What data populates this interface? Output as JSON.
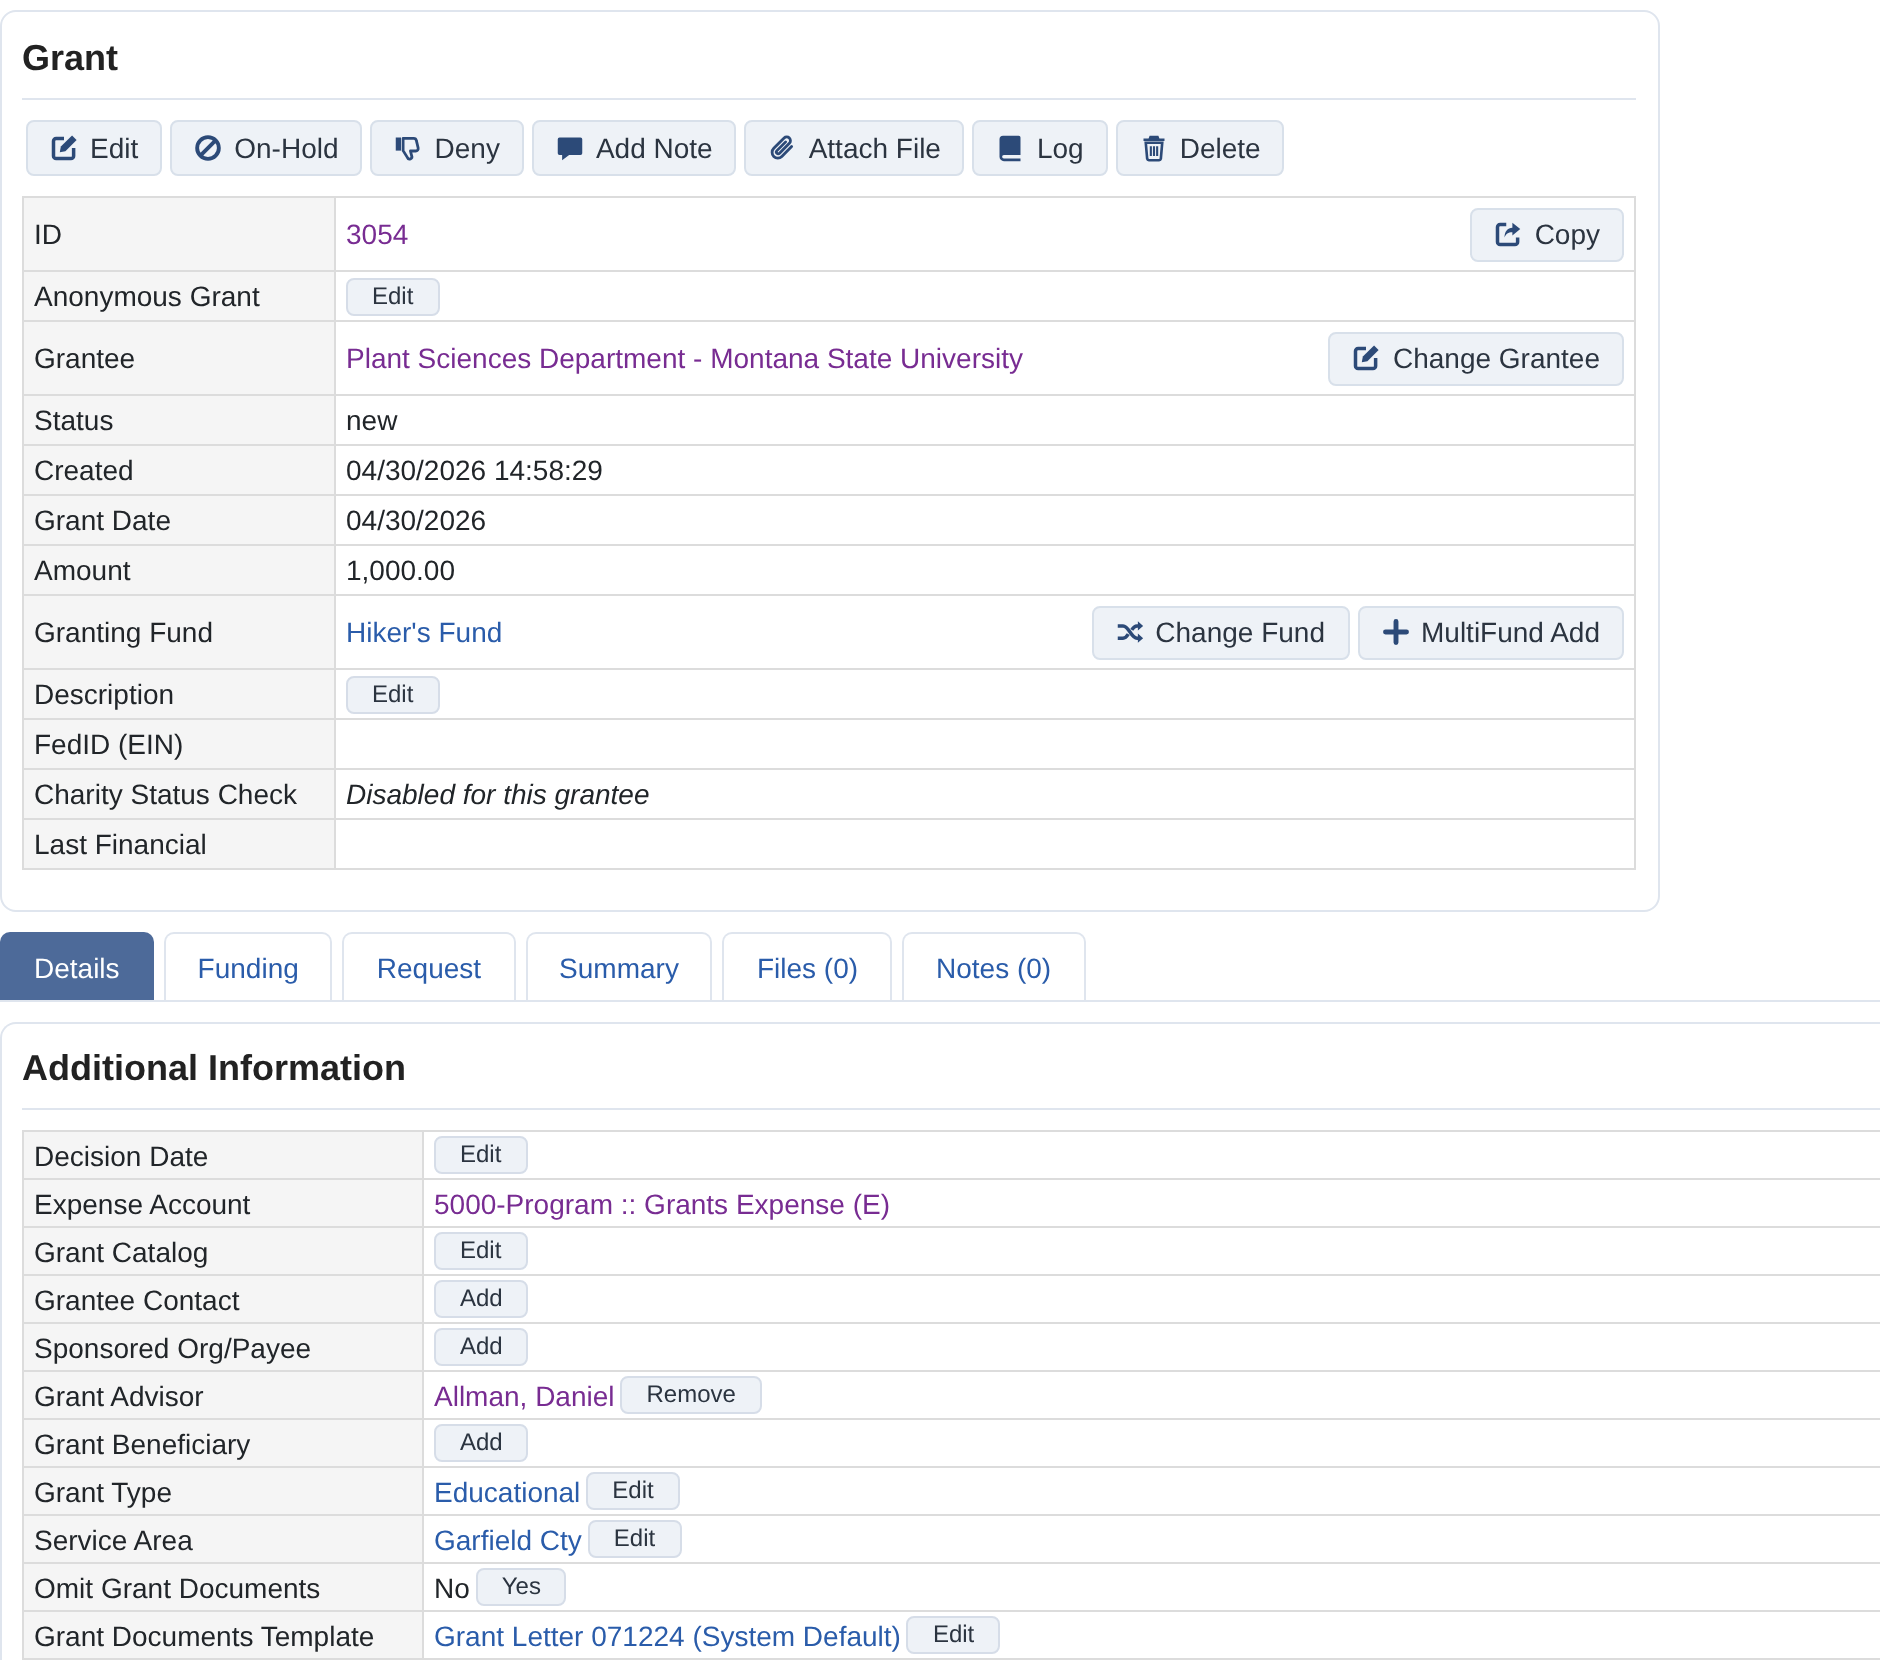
{
  "grant_panel": {
    "title": "Grant",
    "toolbar": [
      {
        "label": "Edit",
        "kind": "edit"
      },
      {
        "label": "On-Hold",
        "kind": "hold"
      },
      {
        "label": "Deny",
        "kind": "deny"
      },
      {
        "label": "Add Note",
        "kind": "note"
      },
      {
        "label": "Attach File",
        "kind": "attach"
      },
      {
        "label": "Log",
        "kind": "log"
      },
      {
        "label": "Delete",
        "kind": "delete"
      }
    ],
    "fields": [
      {
        "label": "ID",
        "value": {
          "kind": "link",
          "text": "3054",
          "visited": true
        },
        "side_buttons": [
          {
            "label": "Copy",
            "kind": "copy"
          }
        ]
      },
      {
        "label": "Anonymous Grant",
        "inline_buttons": [
          "Edit"
        ]
      },
      {
        "label": "Grantee",
        "value": {
          "kind": "link",
          "text": "Plant Sciences Department - Montana State University",
          "visited": true
        },
        "side_buttons": [
          {
            "label": "Change Grantee",
            "kind": "reassign"
          }
        ]
      },
      {
        "label": "Status",
        "value": {
          "kind": "text",
          "text": "new"
        }
      },
      {
        "label": "Created",
        "value": {
          "kind": "text",
          "text": "04/30/2026 14:58:29"
        }
      },
      {
        "label": "Grant Date",
        "value": {
          "kind": "text",
          "text": "04/30/2026"
        }
      },
      {
        "label": "Amount",
        "value": {
          "kind": "text",
          "text": "1,000.00"
        }
      },
      {
        "label": "Granting Fund",
        "value": {
          "kind": "link",
          "text": "Hiker's Fund",
          "visited": false
        },
        "side_buttons": [
          {
            "label": "Change Fund",
            "kind": "shuffle"
          },
          {
            "label": "MultiFund Add",
            "kind": "add"
          }
        ]
      },
      {
        "label": "Description",
        "inline_buttons": [
          "Edit"
        ]
      },
      {
        "label": "FedID (EIN)"
      },
      {
        "label": "Charity Status Check",
        "value": {
          "kind": "note",
          "text": "Disabled for this grantee"
        }
      },
      {
        "label": "Last Financial"
      }
    ]
  },
  "tabs": [
    {
      "label": "Details",
      "selected": true
    },
    {
      "label": "Funding",
      "selected": false
    },
    {
      "label": "Request",
      "selected": false
    },
    {
      "label": "Summary",
      "selected": false
    },
    {
      "label": "Files (0)",
      "selected": false
    },
    {
      "label": "Notes (0)",
      "selected": false
    }
  ],
  "additional_information": {
    "title": "Additional Information",
    "fields": [
      {
        "label": "Decision Date",
        "inline_buttons": [
          "Edit"
        ]
      },
      {
        "label": "Expense Account",
        "value": {
          "kind": "link",
          "text": "5000-Program :: Grants Expense (E)",
          "visited": true
        }
      },
      {
        "label": "Grant Catalog",
        "inline_buttons": [
          "Edit"
        ]
      },
      {
        "label": "Grantee Contact",
        "inline_buttons": [
          "Add"
        ]
      },
      {
        "label": "Sponsored Org/Payee",
        "inline_buttons": [
          "Add"
        ]
      },
      {
        "label": "Grant Advisor",
        "value": {
          "kind": "link",
          "text": "Allman, Daniel",
          "visited": true
        },
        "inline_buttons": [
          "Remove"
        ]
      },
      {
        "label": "Grant Beneficiary",
        "inline_buttons": [
          "Add"
        ]
      },
      {
        "label": "Grant Type",
        "value": {
          "kind": "link",
          "text": "Educational",
          "visited": false
        },
        "inline_buttons": [
          "Edit"
        ]
      },
      {
        "label": "Service Area",
        "value": {
          "kind": "link",
          "text": "Garfield Cty",
          "visited": false
        },
        "inline_buttons": [
          "Edit"
        ]
      },
      {
        "label": "Omit Grant Documents",
        "value": {
          "kind": "text",
          "text": "No"
        },
        "inline_buttons": [
          "Yes"
        ]
      },
      {
        "label": "Grant Documents Template",
        "value": {
          "kind": "link",
          "text": "Grant Letter 071224 (System Default)",
          "visited": false
        },
        "inline_buttons": [
          "Edit"
        ]
      }
    ]
  }
}
